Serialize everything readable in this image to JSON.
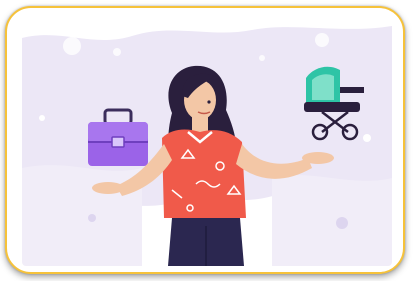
{
  "image": {
    "subject": "woman-balancing-career-and-family",
    "left_object": "purple-briefcase",
    "right_object": "green-baby-stroller",
    "colors": {
      "frame_border": "#f6c23a",
      "blob": "#ece7f6",
      "briefcase": "#9b63e8",
      "stroller_hood": "#2ec4a6",
      "shirt": "#f05a4a",
      "hair": "#2a1f3d",
      "pants": "#2b2750",
      "skin": "#f3c7a6"
    }
  }
}
